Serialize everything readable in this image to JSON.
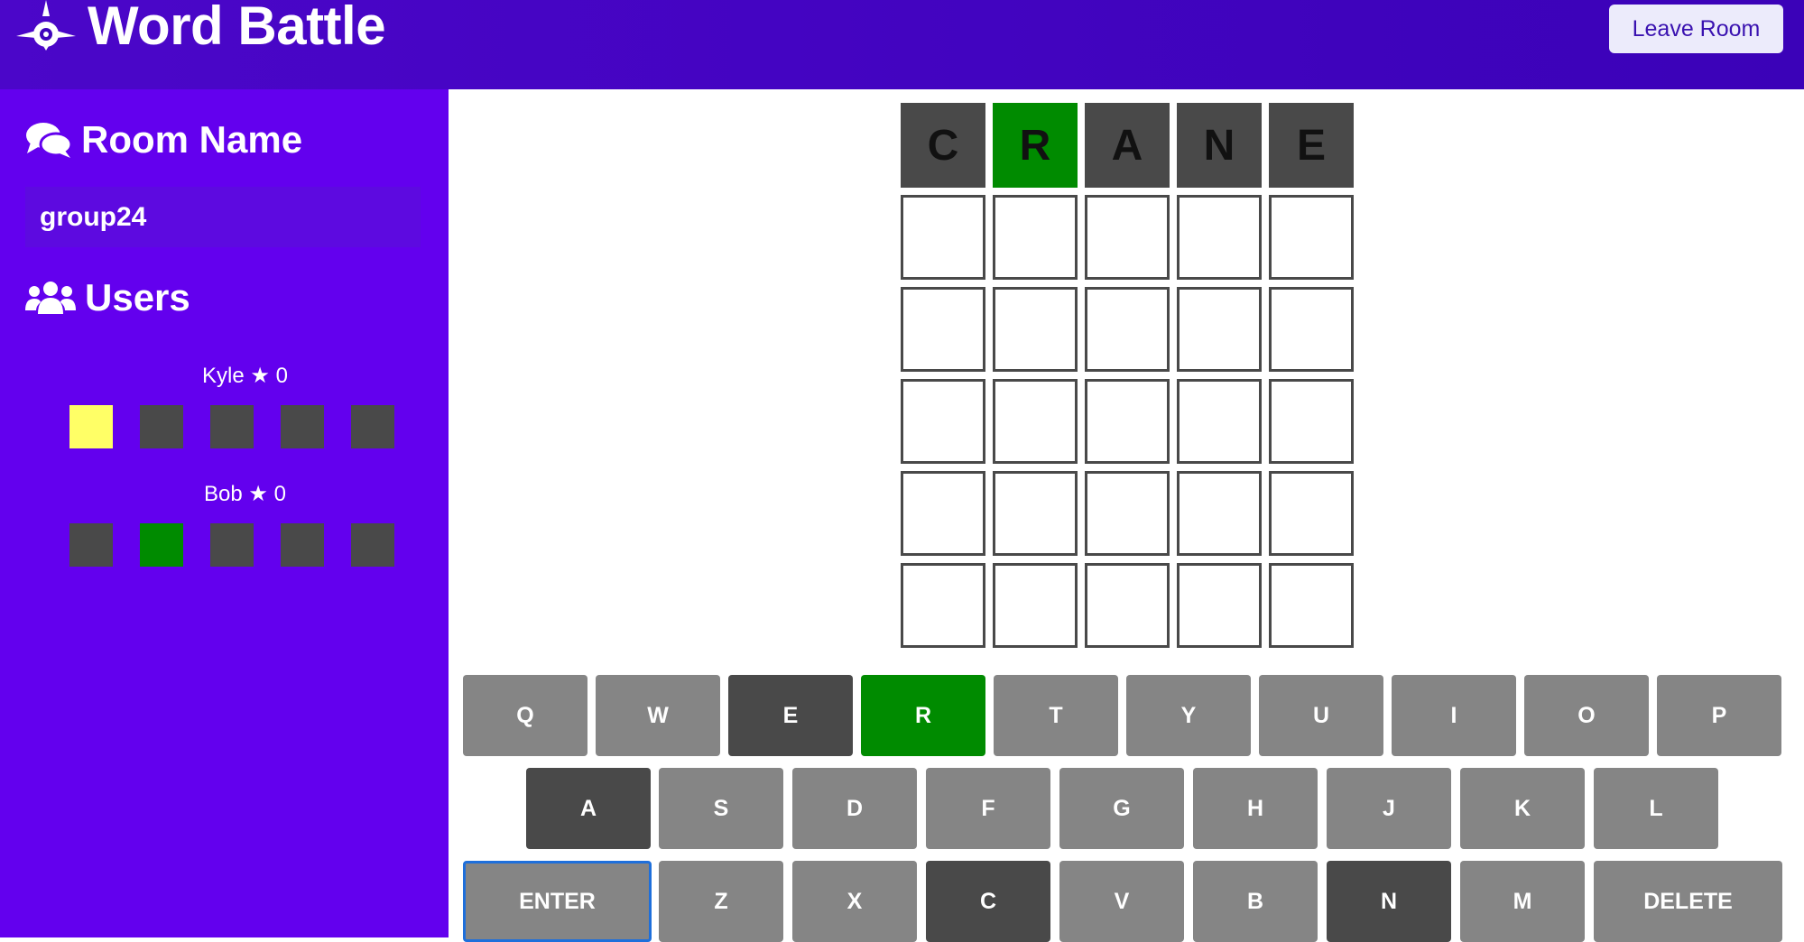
{
  "header": {
    "title": "Word Battle",
    "leave_label": "Leave Room",
    "logo_icon": "ship-helm-logo-icon"
  },
  "sidebar": {
    "room_heading": "Room Name",
    "room_icon": "chat-bubbles-icon",
    "room_name": "group24",
    "users_heading": "Users",
    "users_icon": "users-group-icon",
    "star_icon": "star-icon",
    "users": [
      {
        "name": "Kyle",
        "score": "0",
        "tiles": [
          "yellow",
          "gray",
          "gray",
          "gray",
          "gray"
        ]
      },
      {
        "name": "Bob",
        "score": "0",
        "tiles": [
          "gray",
          "green",
          "gray",
          "gray",
          "gray"
        ]
      }
    ]
  },
  "board": {
    "rows": [
      {
        "letters": [
          "C",
          "R",
          "A",
          "N",
          "E"
        ],
        "states": [
          "absent",
          "correct",
          "absent",
          "absent",
          "absent"
        ]
      },
      {
        "letters": [
          "",
          "",
          "",
          "",
          ""
        ],
        "states": [
          "empty",
          "empty",
          "empty",
          "empty",
          "empty"
        ]
      },
      {
        "letters": [
          "",
          "",
          "",
          "",
          ""
        ],
        "states": [
          "empty",
          "empty",
          "empty",
          "empty",
          "empty"
        ]
      },
      {
        "letters": [
          "",
          "",
          "",
          "",
          ""
        ],
        "states": [
          "empty",
          "empty",
          "empty",
          "empty",
          "empty"
        ]
      },
      {
        "letters": [
          "",
          "",
          "",
          "",
          ""
        ],
        "states": [
          "empty",
          "empty",
          "empty",
          "empty",
          "empty"
        ]
      },
      {
        "letters": [
          "",
          "",
          "",
          "",
          ""
        ],
        "states": [
          "empty",
          "empty",
          "empty",
          "empty",
          "empty"
        ]
      }
    ]
  },
  "keyboard": {
    "rows": [
      [
        {
          "label": "Q",
          "state": "unused"
        },
        {
          "label": "W",
          "state": "unused"
        },
        {
          "label": "E",
          "state": "absent"
        },
        {
          "label": "R",
          "state": "correct"
        },
        {
          "label": "T",
          "state": "unused"
        },
        {
          "label": "Y",
          "state": "unused"
        },
        {
          "label": "U",
          "state": "unused"
        },
        {
          "label": "I",
          "state": "unused"
        },
        {
          "label": "O",
          "state": "unused"
        },
        {
          "label": "P",
          "state": "unused"
        }
      ],
      [
        {
          "label": "A",
          "state": "absent"
        },
        {
          "label": "S",
          "state": "unused"
        },
        {
          "label": "D",
          "state": "unused"
        },
        {
          "label": "F",
          "state": "unused"
        },
        {
          "label": "G",
          "state": "unused"
        },
        {
          "label": "H",
          "state": "unused"
        },
        {
          "label": "J",
          "state": "unused"
        },
        {
          "label": "K",
          "state": "unused"
        },
        {
          "label": "L",
          "state": "unused"
        }
      ],
      [
        {
          "label": "ENTER",
          "state": "unused"
        },
        {
          "label": "Z",
          "state": "unused"
        },
        {
          "label": "X",
          "state": "unused"
        },
        {
          "label": "C",
          "state": "absent"
        },
        {
          "label": "V",
          "state": "unused"
        },
        {
          "label": "B",
          "state": "unused"
        },
        {
          "label": "N",
          "state": "absent"
        },
        {
          "label": "M",
          "state": "unused"
        },
        {
          "label": "DELETE",
          "state": "unused"
        }
      ]
    ]
  },
  "colors": {
    "header_bg": "#3b02b8",
    "sidebar_bg": "#6300ee",
    "absent": "#494949",
    "correct": "#008b00",
    "present": "#ffff66",
    "unused_key": "#858585"
  }
}
